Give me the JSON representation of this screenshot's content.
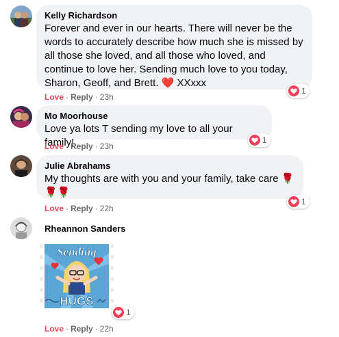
{
  "comments": [
    {
      "author": "Kelly Richardson",
      "text": "Forever and ever in our hearts. There will never be the words to accurately describe how much she is missed by all those she loved, and all those who loved, and continue to love her. Sending much love to you today, Sharon, Geoff, and Brett.",
      "text_suffix": "XXxxx",
      "reaction_icon": "red-heart-emoji",
      "love_label": "Love",
      "reply_label": "Reply",
      "time": "23h",
      "reaction_count": "1"
    },
    {
      "author": "Mo Moorhouse",
      "text": "Love ya lots T sending my love to all your family!",
      "love_label": "Love",
      "reply_label": "Reply",
      "time": "23h",
      "reaction_count": "1"
    },
    {
      "author": "Julie Abrahams",
      "text": "My thoughts are with you and your family, take care",
      "emoji": "rose-emoji",
      "love_label": "Love",
      "reply_label": "Reply",
      "time": "22h",
      "reaction_count": "1"
    },
    {
      "author": "Rheannon Sanders",
      "sticker": "sending-hugs-sticker",
      "sticker_text_top": "Sending",
      "sticker_text_bottom": "HUGS",
      "love_label": "Love",
      "reply_label": "Reply",
      "time": "22h",
      "reaction_count": "1"
    }
  ],
  "colors": {
    "bubble": "#f0f2f5",
    "love": "#e4465b",
    "meta": "#65676b",
    "heart_badge": "#f33e58"
  }
}
